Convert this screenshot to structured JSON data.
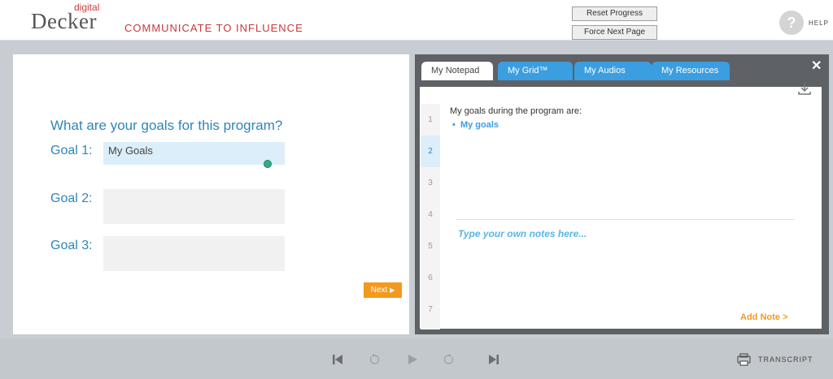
{
  "header": {
    "logo_small": "digital",
    "logo_main": "Decker",
    "tagline": "COMMUNICATE TO INFLUENCE",
    "reset_label": "Reset Progress",
    "force_label": "Force Next Page",
    "help_symbol": "?",
    "help_label": "HELP"
  },
  "left": {
    "question": "What are your goals for this program?",
    "goals": [
      {
        "label": "Goal 1:",
        "value": "My Goals"
      },
      {
        "label": "Goal 2:",
        "value": ""
      },
      {
        "label": "Goal 3:",
        "value": ""
      }
    ],
    "next_label": "Next"
  },
  "notepad": {
    "close_symbol": "✕",
    "tabs": [
      {
        "label": "My Notepad",
        "active": true
      },
      {
        "label": "My Grid™",
        "active": false
      },
      {
        "label": "My Audios",
        "active": false
      },
      {
        "label": "My Resources",
        "active": false
      }
    ],
    "line_numbers": [
      "1",
      "2",
      "3",
      "4",
      "5",
      "6",
      "7"
    ],
    "active_line": "2",
    "goals_title": "My goals during the program are:",
    "goal_items": [
      "My goals"
    ],
    "notes_placeholder": "Type your own notes here...",
    "add_note_label": "Add Note >"
  },
  "controls": {
    "icons": [
      "skip-back-icon",
      "rewind-icon",
      "play-icon",
      "forward-icon",
      "skip-forward-icon"
    ],
    "transcript_label": "TRANSCRIPT"
  },
  "colors": {
    "accent_blue": "#3b9ee0",
    "heading_blue": "#2e86b9",
    "orange": "#f39a1e",
    "brand_red": "#c8363b"
  }
}
